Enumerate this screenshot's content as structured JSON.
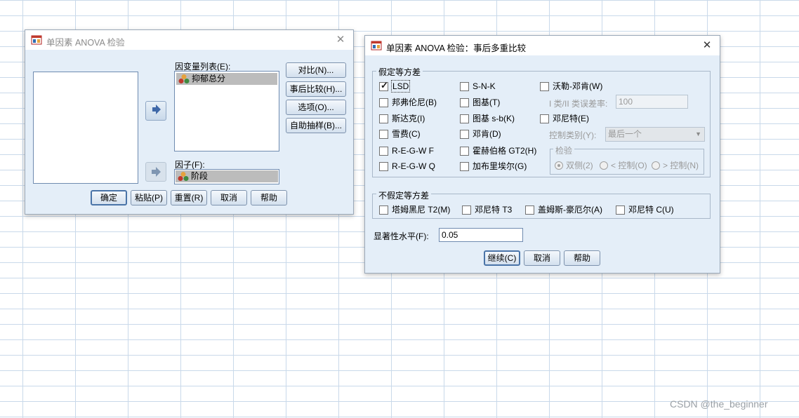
{
  "main_dialog": {
    "title": "单因素 ANOVA 检验",
    "dependent_label": "因变量列表(E):",
    "dependent_item": "抑郁总分",
    "factor_label": "因子(F):",
    "factor_item": "阶段",
    "side_buttons": [
      "对比(N)...",
      "事后比较(H)...",
      "选项(O)...",
      "自助抽样(B)..."
    ],
    "bottom_buttons": [
      "确定",
      "粘贴(P)",
      "重置(R)",
      "取消",
      "帮助"
    ]
  },
  "posthoc_dialog": {
    "title": "单因素 ANOVA 检验：事后多重比较",
    "equal_var_group": "假定等方差",
    "col1": [
      {
        "label": "LSD",
        "checked": true
      },
      {
        "label": "邦弗伦尼(B)",
        "checked": false
      },
      {
        "label": "斯达克(I)",
        "checked": false
      },
      {
        "label": "雪费(C)",
        "checked": false
      },
      {
        "label": "R-E-G-W F",
        "checked": false
      },
      {
        "label": "R-E-G-W Q",
        "checked": false
      }
    ],
    "col2": [
      {
        "label": "S-N-K",
        "checked": false
      },
      {
        "label": "图基(T)",
        "checked": false
      },
      {
        "label": "图基 s-b(K)",
        "checked": false
      },
      {
        "label": "邓肯(D)",
        "checked": false
      },
      {
        "label": "霍赫伯格 GT2(H)",
        "checked": false
      },
      {
        "label": "加布里埃尔(G)",
        "checked": false
      }
    ],
    "waller": {
      "label": "沃勒-邓肯(W)",
      "checked": false
    },
    "error_ratio_label": "I 类/II 类误差率:",
    "error_ratio_value": "100",
    "dunnett": {
      "label": "邓尼特(E)",
      "checked": false
    },
    "control_label": "控制类别(Y):",
    "control_value": "最后一个",
    "test_group": "检验",
    "test_radios": [
      {
        "label": "双侧(2)",
        "selected": true
      },
      {
        "label": "< 控制(O)",
        "selected": false
      },
      {
        "label": "> 控制(N)",
        "selected": false
      }
    ],
    "unequal_var_group": "不假定等方差",
    "unequal": [
      {
        "label": "塔姆黑尼 T2(M)",
        "checked": false
      },
      {
        "label": "邓尼特 T3",
        "checked": false
      },
      {
        "label": "盖姆斯-豪厄尔(A)",
        "checked": false
      },
      {
        "label": "邓尼特 C(U)",
        "checked": false
      }
    ],
    "sig_label": "显著性水平(F):",
    "sig_value": "0.05",
    "buttons": [
      "继续(C)",
      "取消",
      "帮助"
    ]
  },
  "watermark": "CSDN @the_beginner",
  "colors": {
    "dialog_bg": "#e4eef8",
    "grid_line": "#c9d9ea",
    "selected_item": "#bcbcbc",
    "default_border": "#4a74a8"
  },
  "icons": {
    "app": "spss-dialog-icon",
    "variable": "scale-variable-icon",
    "move_in": "move-right-arrow-icon",
    "move_factor": "move-right-arrow-disabled-icon",
    "close": "close-icon"
  }
}
